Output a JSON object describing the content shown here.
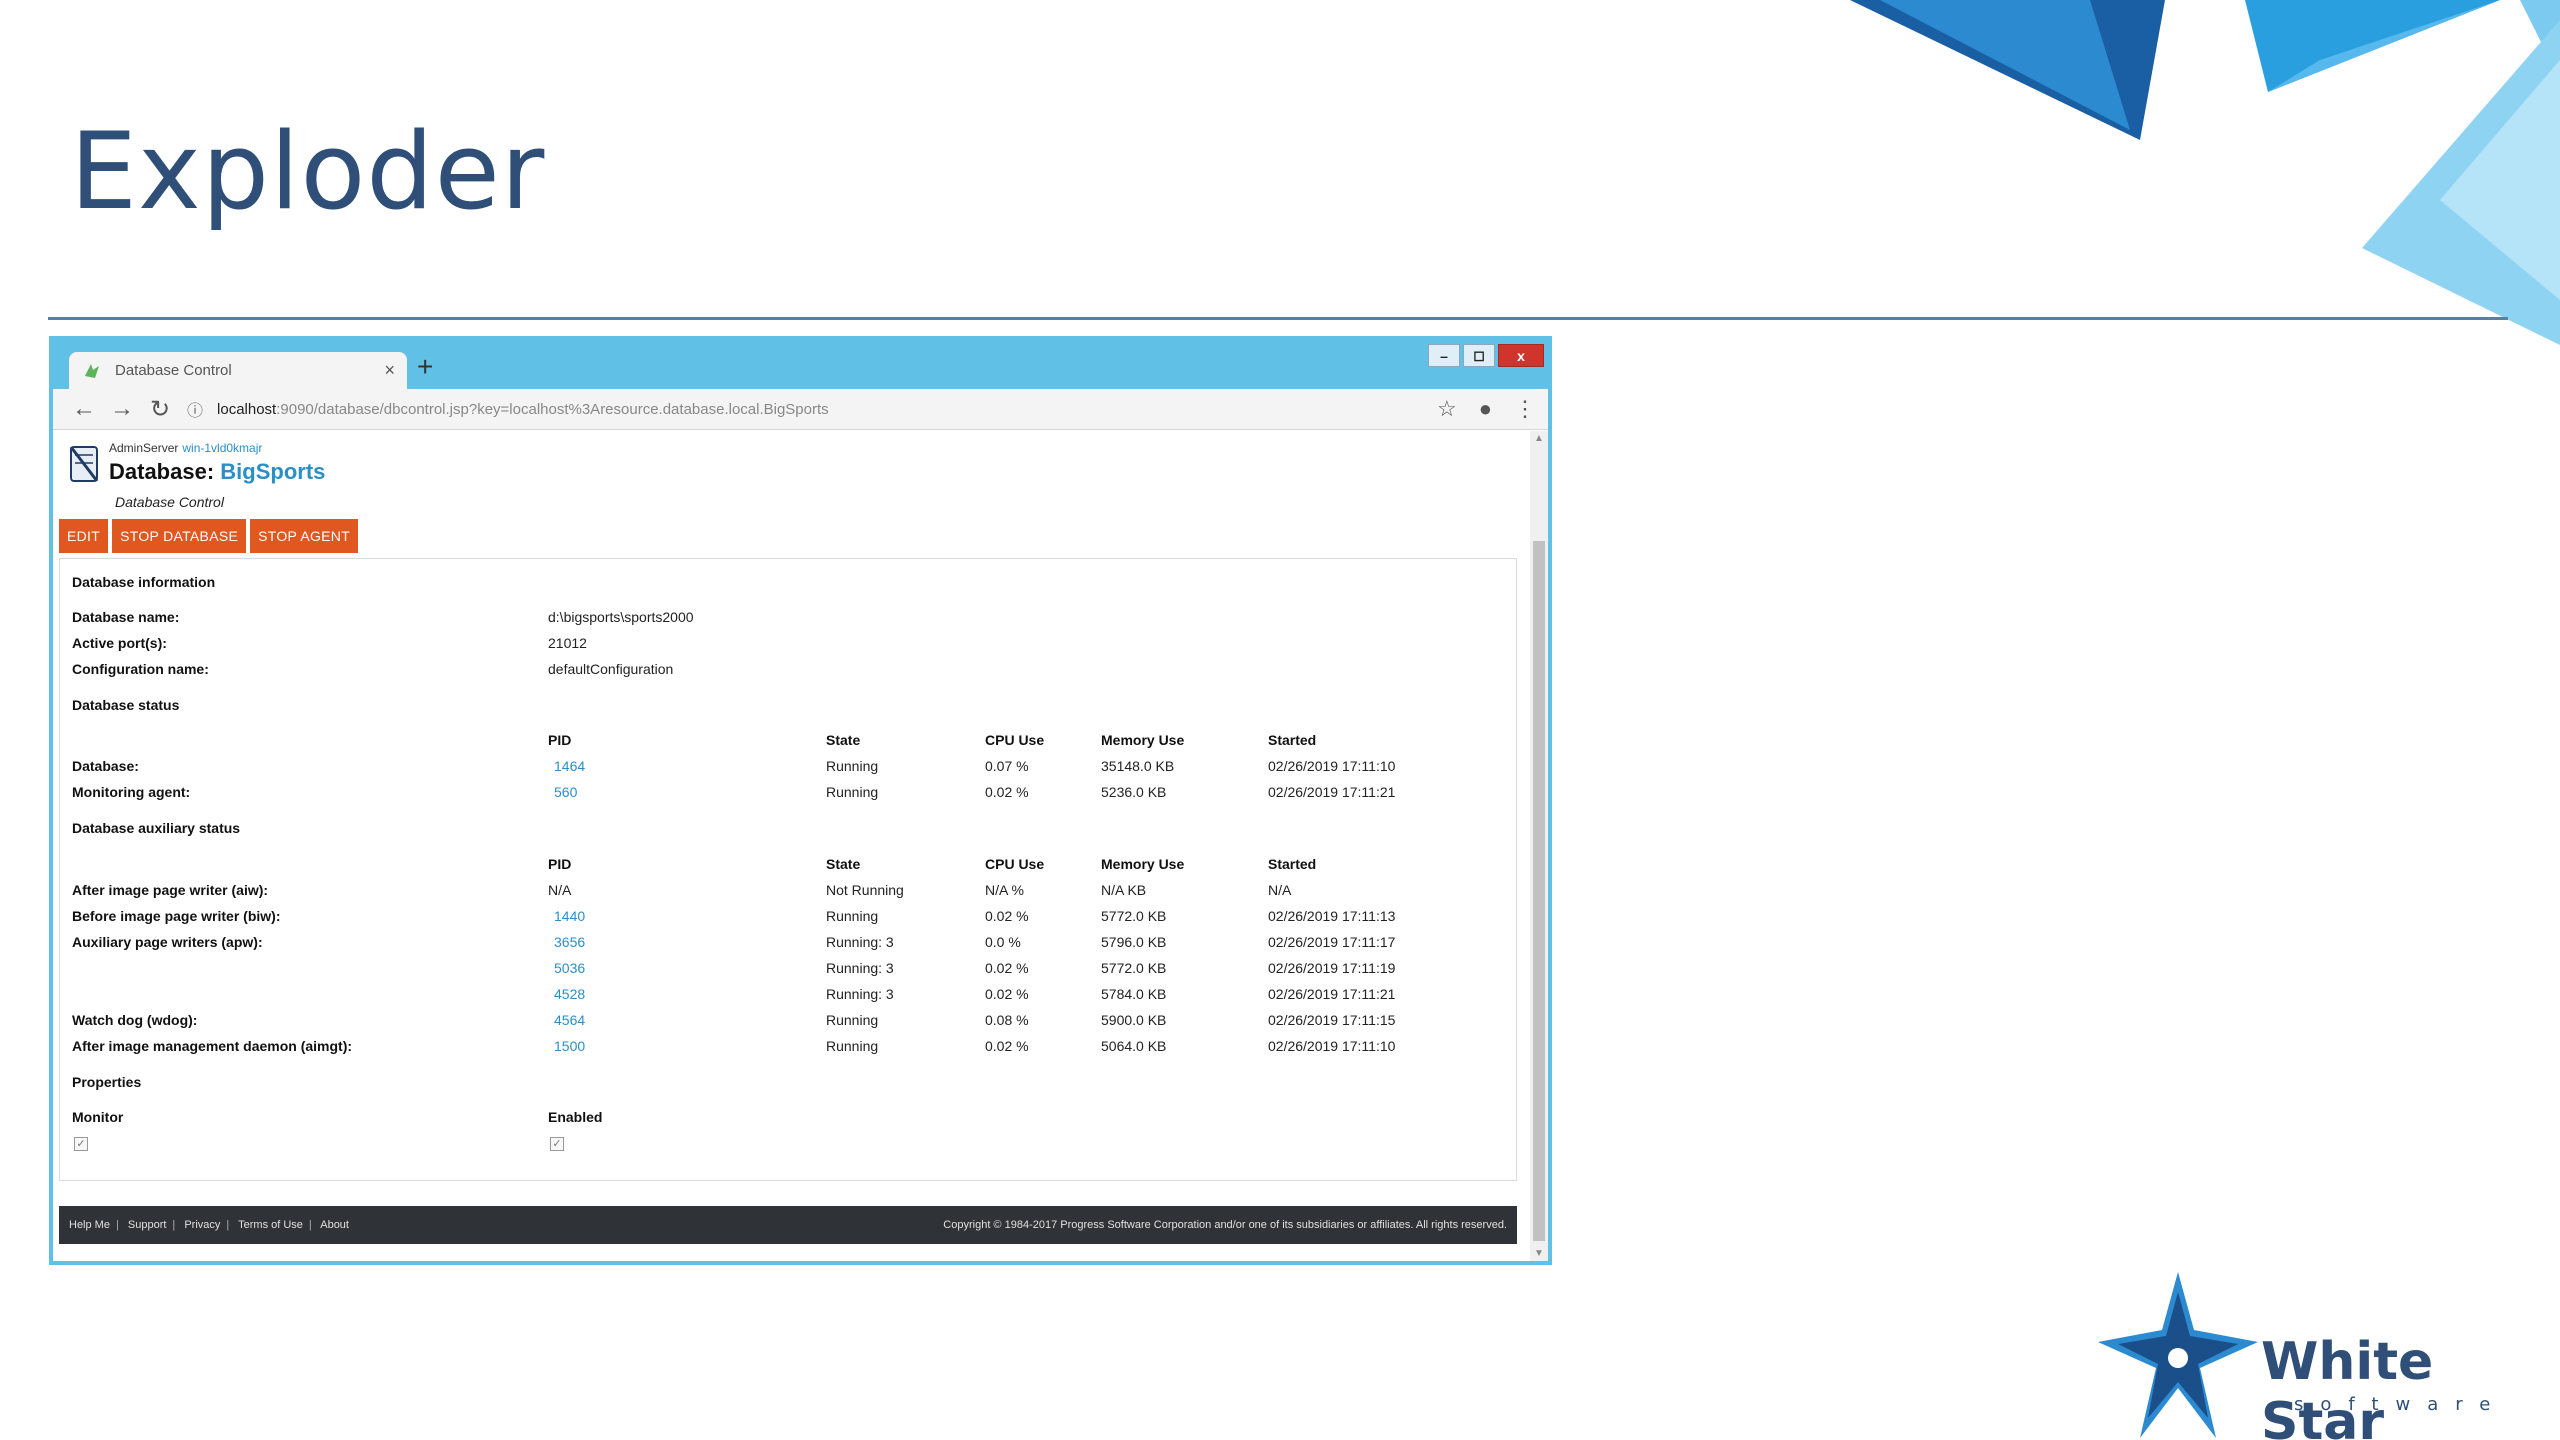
{
  "slide": {
    "title": "Exploder"
  },
  "browser": {
    "tab_title": "Database Control",
    "tab_close": "×",
    "new_tab": "+",
    "window_buttons": {
      "minimize": "–",
      "maximize": "◻",
      "close": "x"
    },
    "address": {
      "host": "localhost",
      "rest": ":9090/database/dbcontrol.jsp?key=localhost%3Aresource.database.local.BigSports"
    }
  },
  "page": {
    "admin_label": "AdminServer",
    "admin_host": "win-1vld0kmajr",
    "title_prefix": "Database:",
    "db_name": "BigSports",
    "subtitle": "Database Control",
    "actions": [
      "EDIT",
      "STOP DATABASE",
      "STOP AGENT"
    ],
    "info": {
      "title": "Database information",
      "rows": [
        {
          "label": "Database name:",
          "value": "d:\\bigsports\\sports2000"
        },
        {
          "label": "Active port(s):",
          "value": "21012"
        },
        {
          "label": "Configuration name:",
          "value": "defaultConfiguration"
        }
      ]
    },
    "status": {
      "title": "Database status",
      "headers": {
        "pid": "PID",
        "state": "State",
        "cpu": "CPU Use",
        "mem": "Memory Use",
        "start": "Started"
      },
      "rows": [
        {
          "label": "Database:",
          "pid": "1464",
          "state": "Running",
          "cpu": "0.07 %",
          "mem": "35148.0 KB",
          "start": "02/26/2019 17:11:10"
        },
        {
          "label": "Monitoring agent:",
          "pid": "560",
          "state": "Running",
          "cpu": "0.02 %",
          "mem": "5236.0 KB",
          "start": "02/26/2019 17:11:21"
        }
      ]
    },
    "aux": {
      "title": "Database auxiliary status",
      "headers": {
        "pid": "PID",
        "state": "State",
        "cpu": "CPU Use",
        "mem": "Memory Use",
        "start": "Started"
      },
      "rows": [
        {
          "label": "After image page writer (aiw):",
          "pid": "N/A",
          "state": "Not Running",
          "cpu": "N/A %",
          "mem": "N/A KB",
          "start": "N/A"
        },
        {
          "label": "Before image page writer (biw):",
          "pid": "1440",
          "state": "Running",
          "cpu": "0.02 %",
          "mem": "5772.0 KB",
          "start": "02/26/2019 17:11:13"
        },
        {
          "label": "Auxiliary page writers (apw):",
          "pid": "3656",
          "state": "Running: 3",
          "cpu": "0.0 %",
          "mem": "5796.0 KB",
          "start": "02/26/2019 17:11:17"
        },
        {
          "label": "",
          "pid": "5036",
          "state": "Running: 3",
          "cpu": "0.02 %",
          "mem": "5772.0 KB",
          "start": "02/26/2019 17:11:19"
        },
        {
          "label": "",
          "pid": "4528",
          "state": "Running: 3",
          "cpu": "0.02 %",
          "mem": "5784.0 KB",
          "start": "02/26/2019 17:11:21"
        },
        {
          "label": "Watch dog (wdog):",
          "pid": "4564",
          "state": "Running",
          "cpu": "0.08 %",
          "mem": "5900.0 KB",
          "start": "02/26/2019 17:11:15"
        },
        {
          "label": "After image management daemon (aimgt):",
          "pid": "1500",
          "state": "Running",
          "cpu": "0.02 %",
          "mem": "5064.0 KB",
          "start": "02/26/2019 17:11:10"
        }
      ]
    },
    "properties": {
      "title": "Properties",
      "monitor_label": "Monitor",
      "enabled_label": "Enabled"
    },
    "footer": {
      "links": [
        "Help Me",
        "Support",
        "Privacy",
        "Terms of Use",
        "About"
      ],
      "copyright": "Copyright © 1984-2017 Progress Software Corporation and/or one of its subsidiaries or affiliates. All rights reserved."
    }
  },
  "logo": {
    "name": "White Star",
    "tagline": "software"
  },
  "colors": {
    "title_blue": "#2f4f78",
    "browser_frame": "#61c0e6",
    "action_orange": "#e0571f",
    "link_blue": "#2a8fc8",
    "footer_dark": "#2f3236"
  }
}
